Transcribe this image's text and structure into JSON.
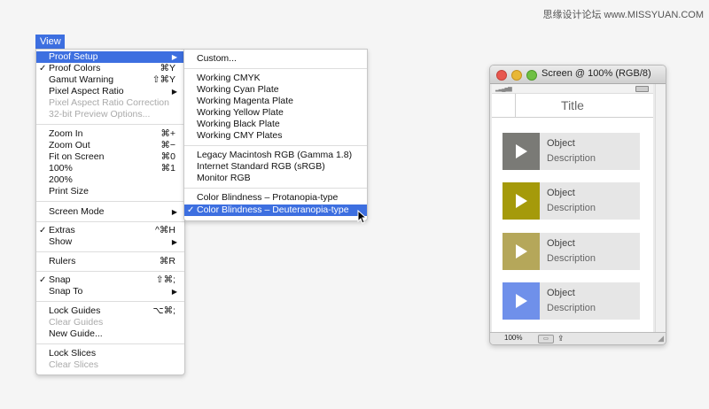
{
  "watermark": "思缘设计论坛 www.MISSYUAN.COM",
  "view_menu_title": "View",
  "main_menu": {
    "proof_setup": {
      "label": "Proof Setup",
      "arrow": "▶"
    },
    "proof_colors": {
      "label": "Proof Colors",
      "check": "✓",
      "shortcut": "⌘Y"
    },
    "gamut_warning": {
      "label": "Gamut Warning",
      "shortcut": "⇧⌘Y"
    },
    "pixel_aspect_ratio": {
      "label": "Pixel Aspect Ratio",
      "arrow": "▶"
    },
    "pixel_aspect_correction": {
      "label": "Pixel Aspect Ratio Correction"
    },
    "preview_32bit": {
      "label": "32-bit Preview Options..."
    },
    "zoom_in": {
      "label": "Zoom In",
      "shortcut": "⌘+"
    },
    "zoom_out": {
      "label": "Zoom Out",
      "shortcut": "⌘−"
    },
    "fit_on_screen": {
      "label": "Fit on Screen",
      "shortcut": "⌘0"
    },
    "pct100": {
      "label": "100%",
      "shortcut": "⌘1"
    },
    "pct200": {
      "label": "200%"
    },
    "print_size": {
      "label": "Print Size"
    },
    "screen_mode": {
      "label": "Screen Mode",
      "arrow": "▶"
    },
    "extras": {
      "label": "Extras",
      "check": "✓",
      "shortcut": "^⌘H"
    },
    "show": {
      "label": "Show",
      "arrow": "▶"
    },
    "rulers": {
      "label": "Rulers",
      "shortcut": "⌘R"
    },
    "snap": {
      "label": "Snap",
      "check": "✓",
      "shortcut": "⇧⌘;"
    },
    "snap_to": {
      "label": "Snap To",
      "arrow": "▶"
    },
    "lock_guides": {
      "label": "Lock Guides",
      "shortcut": "⌥⌘;"
    },
    "clear_guides": {
      "label": "Clear Guides"
    },
    "new_guide": {
      "label": "New Guide..."
    },
    "lock_slices": {
      "label": "Lock Slices"
    },
    "clear_slices": {
      "label": "Clear Slices"
    }
  },
  "submenu": {
    "custom": "Custom...",
    "working_cmyk": "Working CMYK",
    "working_cyan": "Working Cyan Plate",
    "working_magenta": "Working Magenta Plate",
    "working_yellow": "Working Yellow Plate",
    "working_black": "Working Black Plate",
    "working_cmy": "Working CMY Plates",
    "legacy_mac": "Legacy Macintosh RGB (Gamma 1.8)",
    "internet_srgb": "Internet Standard RGB (sRGB)",
    "monitor_rgb": "Monitor RGB",
    "protanopia": "Color Blindness – Protanopia-type",
    "deuteranopia": "Color Blindness – Deuteranopia-type",
    "deuteranopia_check": "✓"
  },
  "window": {
    "title": "Screen @ 100% (RGB/8)",
    "nav_title": "Title",
    "zoom": "100%",
    "cards": [
      {
        "title": "Object",
        "description": "Description",
        "color": "#7a7a76"
      },
      {
        "title": "Object",
        "description": "Description",
        "color": "#a59a0a"
      },
      {
        "title": "Object",
        "description": "Description",
        "color": "#b5a75a"
      },
      {
        "title": "Object",
        "description": "Description",
        "color": "#6f90ea"
      }
    ]
  },
  "colors": {
    "highlight": "#3d6fe0"
  }
}
